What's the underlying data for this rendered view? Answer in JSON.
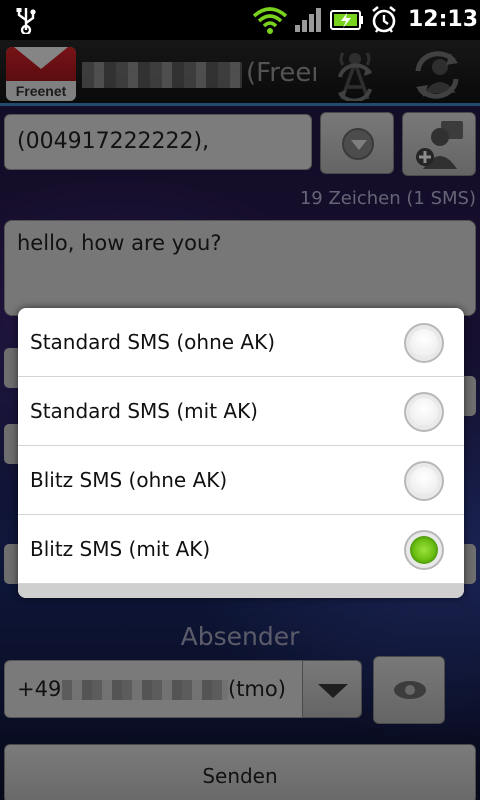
{
  "status_bar": {
    "time": "12:13",
    "icons": [
      "usb-icon",
      "wifi-icon",
      "signal-icon",
      "battery-charging-icon",
      "alarm-icon"
    ]
  },
  "title_bar": {
    "logo_text": "Freenet",
    "account_title": "(Freen",
    "icons": [
      "sync-antenna-icon",
      "sync-contacts-icon"
    ],
    "accent_color": "#3b88c8"
  },
  "compose": {
    "recipient": "(004917222222),",
    "char_count": "19 Zeichen (1 SMS)",
    "message": "hello, how are you?"
  },
  "sender": {
    "label": "Absender",
    "prefix": "+49",
    "suffix": "(tmo)"
  },
  "send_button": "Senden",
  "dialog": {
    "options": [
      {
        "label": "Standard SMS (ohne AK)",
        "selected": false
      },
      {
        "label": "Standard SMS (mit AK)",
        "selected": false
      },
      {
        "label": "Blitz SMS (ohne AK)",
        "selected": false
      },
      {
        "label": "Blitz SMS (mit AK)",
        "selected": true
      }
    ],
    "selected_color": "#6cbf12"
  }
}
